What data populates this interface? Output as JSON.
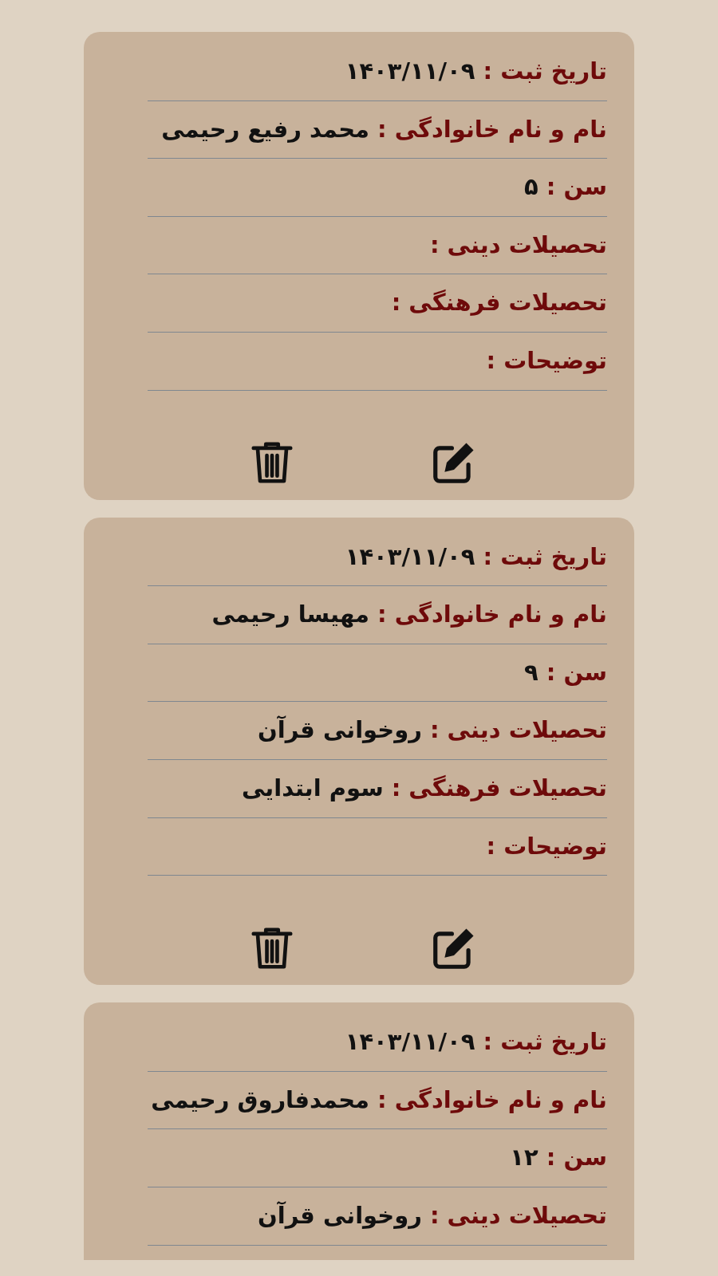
{
  "cards": [
    {
      "rows": [
        {
          "label": "تاریخ ثبت :",
          "value": "۱۴۰۳/۱۱/۰۹"
        },
        {
          "label": "نام و نام خانوادگی :",
          "value": "محمد رفیع رحیمی"
        },
        {
          "label": "سن :",
          "value": "۵"
        },
        {
          "label": "تحصیلات دینی :"
        },
        {
          "label": "تحصیلات فرهنگی :"
        },
        {
          "label": "توضیحات :"
        }
      ],
      "has_actions": true
    },
    {
      "rows": [
        {
          "label": "تاریخ ثبت :",
          "value": "۱۴۰۳/۱۱/۰۹"
        },
        {
          "label": "نام و نام خانوادگی :",
          "value": "مهیسا رحیمی"
        },
        {
          "label": "سن :",
          "value": "۹"
        },
        {
          "label": "تحصیلات دینی :",
          "value": "روخوانی قرآن"
        },
        {
          "label": "تحصیلات فرهنگی :",
          "value": "سوم ابتدایی"
        },
        {
          "label": "توضیحات :"
        }
      ],
      "has_actions": true
    },
    {
      "rows": [
        {
          "label": "تاریخ ثبت :",
          "value": "۱۴۰۳/۱۱/۰۹"
        },
        {
          "label": "نام و نام خانوادگی :",
          "value": "محمدفاروق رحیمی"
        },
        {
          "label": "سن :",
          "value": "۱۲"
        },
        {
          "label": "تحصیلات دینی :",
          "value": "روخوانی قرآن"
        }
      ],
      "has_actions": false
    }
  ]
}
